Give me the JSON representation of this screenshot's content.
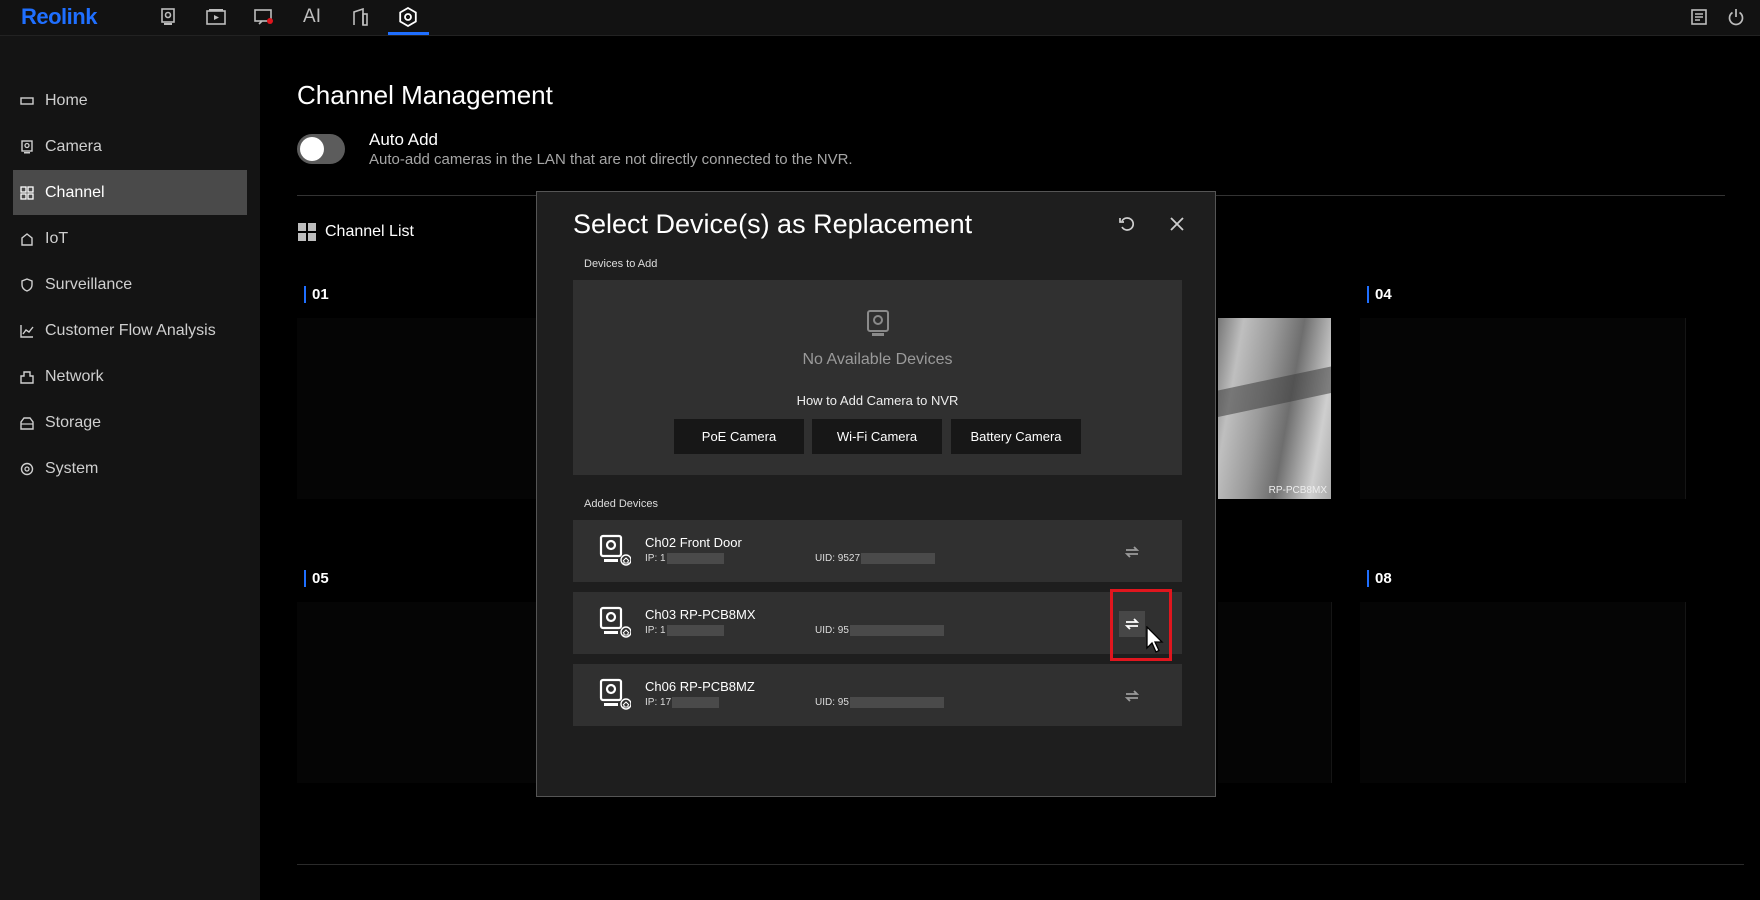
{
  "topbar": {
    "logo": "Reolink",
    "nav_icons": [
      "camera-icon",
      "playback-icon",
      "alarm-icon",
      "ai-icon",
      "device-icon",
      "settings-icon"
    ],
    "ai_label": "AI",
    "active_nav": "settings-icon"
  },
  "sidebar": {
    "items": [
      {
        "label": "Home",
        "icon": "home-icon"
      },
      {
        "label": "Camera",
        "icon": "camera-icon"
      },
      {
        "label": "Channel",
        "icon": "channel-icon"
      },
      {
        "label": "IoT",
        "icon": "iot-icon"
      },
      {
        "label": "Surveillance",
        "icon": "shield-icon"
      },
      {
        "label": "Customer Flow Analysis",
        "icon": "chart-icon"
      },
      {
        "label": "Network",
        "icon": "network-icon"
      },
      {
        "label": "Storage",
        "icon": "storage-icon"
      },
      {
        "label": "System",
        "icon": "system-icon"
      }
    ],
    "active": "Channel"
  },
  "main": {
    "title": "Channel Management",
    "auto_add": {
      "label": "Auto Add",
      "description": "Auto-add cameras in the LAN that are not directly connected to the NVR.",
      "enabled": false
    },
    "channel_list_label": "Channel List",
    "channels": [
      "01",
      "04",
      "05",
      "08"
    ],
    "feed_label": "RP-PCB8MX"
  },
  "modal": {
    "title": "Select Device(s) as Replacement",
    "devices_to_add_label": "Devices to Add",
    "no_devices": "No Available Devices",
    "howto": "How to Add Camera to NVR",
    "buttons": [
      "PoE Camera",
      "Wi-Fi Camera",
      "Battery Camera"
    ],
    "added_devices_label": "Added Devices",
    "devices": [
      {
        "name": "Ch02 Front Door",
        "ip": "IP: 1",
        "uid": "UID: 9527"
      },
      {
        "name": "Ch03 RP-PCB8MX",
        "ip": "IP: 1",
        "uid": "UID: 95"
      },
      {
        "name": "Ch06 RP-PCB8MZ",
        "ip": "IP: 17",
        "uid": "UID: 95"
      }
    ]
  },
  "colors": {
    "accent": "#1f6fff",
    "highlight": "#e0161e"
  }
}
